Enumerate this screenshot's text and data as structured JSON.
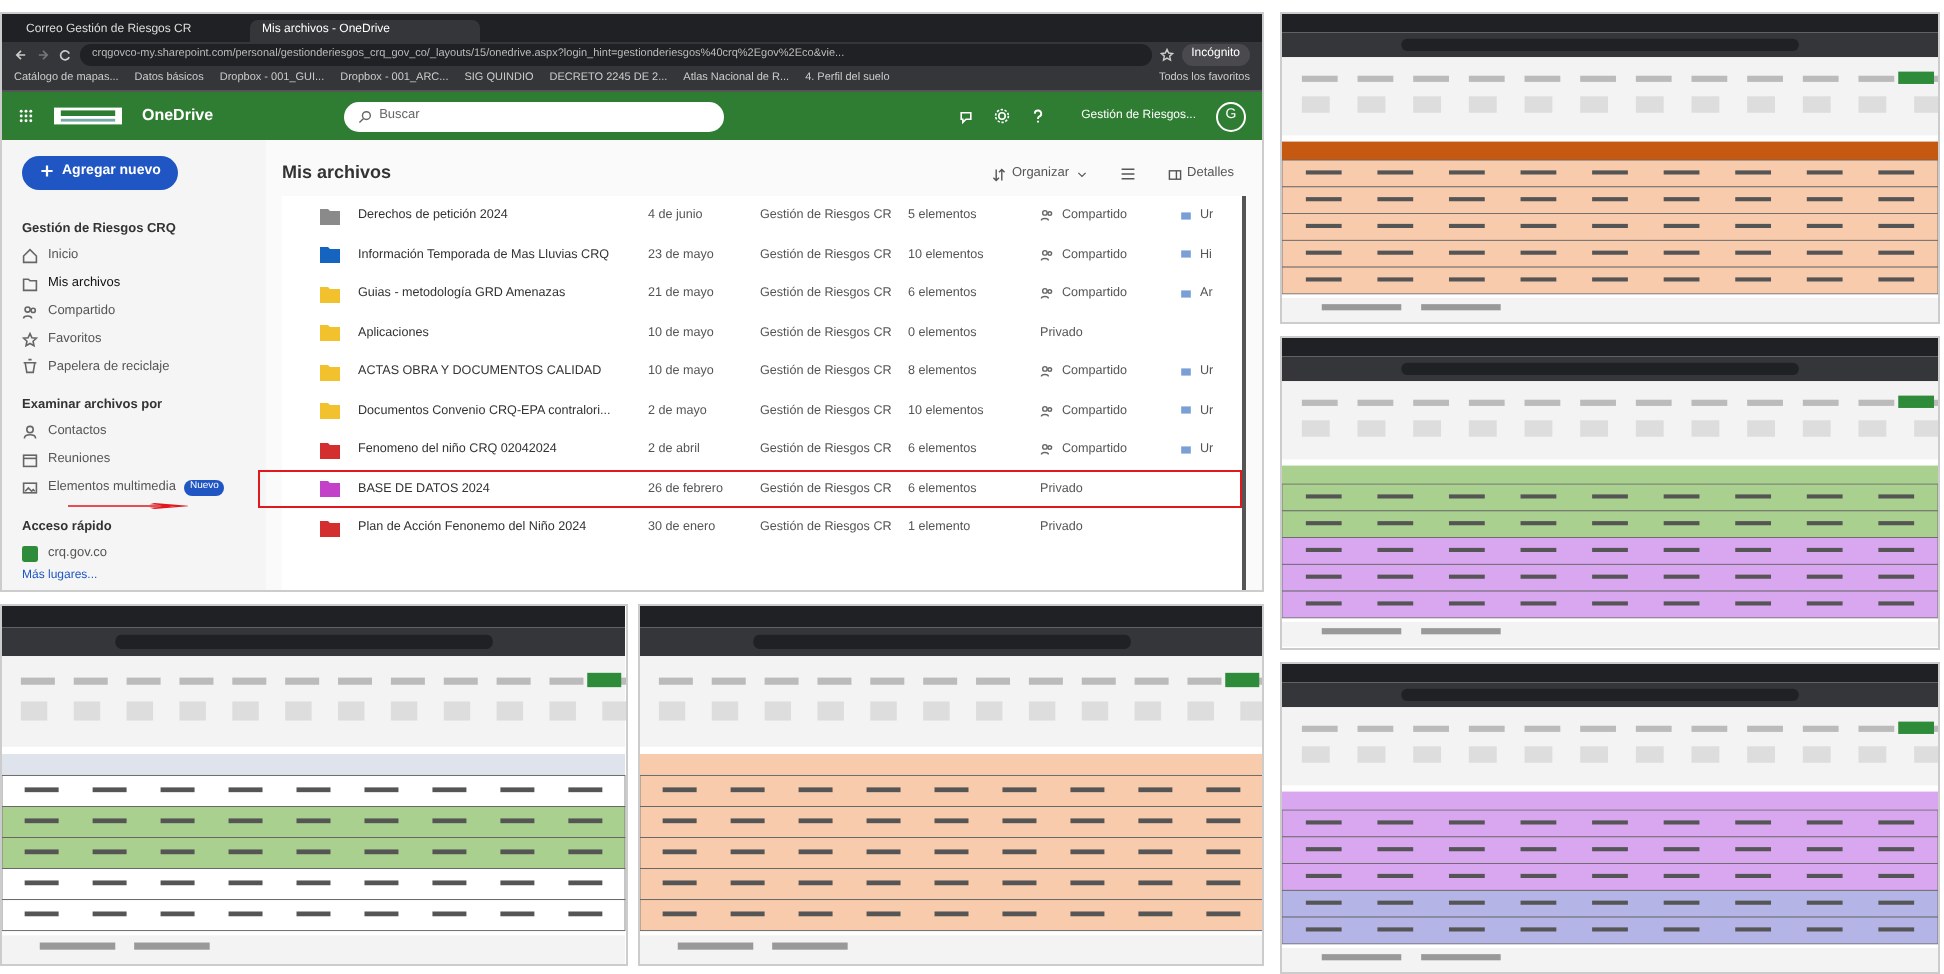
{
  "browser": {
    "tabs": [
      {
        "label": "Correo Gestión de Riesgos CR",
        "selected": false
      },
      {
        "label": "Mis archivos - OneDrive",
        "selected": true
      }
    ],
    "url": "crqgovco-my.sharepoint.com/personal/gestionderiesgos_crq_gov_co/_layouts/15/onedrive.aspx?login_hint=gestionderiesgos%40crq%2Egov%2Eco&vie...",
    "profile": "Incógnito",
    "bookmarks": [
      "Catálogo de mapas...",
      "Datos básicos",
      "Dropbox - 001_GUI...",
      "Dropbox - 001_ARC...",
      "SIG QUINDIO",
      "DECRETO 2245 DE 2...",
      "Atlas Nacional de R...",
      "4. Perfil del suelo"
    ],
    "all_bookmarks": "Todos los favoritos"
  },
  "app": {
    "name": "OneDrive",
    "search_placeholder": "Buscar",
    "account": "Gestión de Riesgos...",
    "avatar": "G"
  },
  "sidebar": {
    "new_button": "Agregar nuevo",
    "sections": [
      {
        "title": "Gestión de Riesgos CRQ",
        "items": [
          {
            "label": "Inicio",
            "selected": false
          },
          {
            "label": "Mis archivos",
            "selected": true
          },
          {
            "label": "Compartido",
            "selected": false
          },
          {
            "label": "Favoritos",
            "selected": false
          },
          {
            "label": "Papelera de reciclaje",
            "selected": false
          }
        ]
      },
      {
        "title": "Examinar archivos por",
        "items": [
          {
            "label": "Contactos",
            "selected": false
          },
          {
            "label": "Reuniones",
            "selected": false
          },
          {
            "label": "Elementos multimedia",
            "selected": false,
            "badge": "Nuevo"
          }
        ]
      },
      {
        "title": "Acceso rápido",
        "items": [
          {
            "label": "crq.gov.co",
            "selected": false
          }
        ]
      }
    ],
    "more": "Más lugares..."
  },
  "toolbar": {
    "title": "Mis archivos",
    "sort": "Organizar",
    "details": "Detalles"
  },
  "files": [
    {
      "name": "Derechos de petición 2024",
      "color": "#8a8a8a",
      "modified": "4 de junio",
      "owner": "Gestión de Riesgos CR",
      "size": "5 elementos",
      "sharing": "Compartido",
      "shared": true,
      "activity": "Ur",
      "highlighted": false
    },
    {
      "name": "Información Temporada de Mas Lluvias CRQ",
      "color": "#1565c0",
      "modified": "23 de mayo",
      "owner": "Gestión de Riesgos CR",
      "size": "10 elementos",
      "sharing": "Compartido",
      "shared": true,
      "activity": "Hi",
      "highlighted": false
    },
    {
      "name": "Guias - metodología GRD Amenazas",
      "color": "#f2c12e",
      "modified": "21 de mayo",
      "owner": "Gestión de Riesgos CR",
      "size": "6 elementos",
      "sharing": "Compartido",
      "shared": true,
      "activity": "Ar",
      "highlighted": false
    },
    {
      "name": "Aplicaciones",
      "color": "#f2c12e",
      "modified": "10 de mayo",
      "owner": "Gestión de Riesgos CR",
      "size": "0 elementos",
      "sharing": "Privado",
      "shared": false,
      "highlighted": false
    },
    {
      "name": "ACTAS OBRA Y DOCUMENTOS CALIDAD",
      "color": "#f2c12e",
      "modified": "10 de mayo",
      "owner": "Gestión de Riesgos CR",
      "size": "8 elementos",
      "sharing": "Compartido",
      "shared": true,
      "activity": "Ur",
      "highlighted": false
    },
    {
      "name": "Documentos Convenio CRQ-EPA contralori...",
      "color": "#f2c12e",
      "modified": "2 de mayo",
      "owner": "Gestión de Riesgos CR",
      "size": "10 elementos",
      "sharing": "Compartido",
      "shared": true,
      "activity": "Ur",
      "highlighted": false
    },
    {
      "name": "Fenomeno del niño CRQ 02042024",
      "color": "#d32f2f",
      "modified": "2 de abril",
      "owner": "Gestión de Riesgos CR",
      "size": "6 elementos",
      "sharing": "Compartido",
      "shared": true,
      "activity": "Ur",
      "highlighted": false
    },
    {
      "name": "BASE DE DATOS 2024",
      "color": "#c341c9",
      "modified": "26 de febrero",
      "owner": "Gestión de Riesgos CR",
      "size": "6 elementos",
      "sharing": "Privado",
      "shared": false,
      "highlighted": true
    },
    {
      "name": "Plan de Acción Fenonemo del Niño 2024",
      "color": "#d32f2f",
      "modified": "30 de enero",
      "owner": "Gestión de Riesgos CR",
      "size": "1 elemento",
      "sharing": "Privado",
      "shared": false,
      "highlighted": false
    }
  ],
  "thumbnails": [
    {
      "header": {
        "color": "#c65911"
      },
      "rows": [
        {
          "color": "#f8cbad"
        },
        {
          "color": "#f8cbad"
        },
        {
          "color": "#f8cbad"
        },
        {
          "color": "#f8cbad"
        },
        {
          "color": "#f8cbad"
        }
      ]
    },
    {
      "header": {
        "color": "#a9d08e"
      },
      "rows": [
        {
          "color": "#a9d08e"
        },
        {
          "color": "#a9d08e"
        },
        {
          "color": "#d9a6f0"
        },
        {
          "color": "#d9a6f0"
        },
        {
          "color": "#d9a6f0"
        }
      ]
    },
    {
      "header": {
        "color": "#d9a6f0"
      },
      "rows": [
        {
          "color": "#d9a6f0"
        },
        {
          "color": "#d9a6f0"
        },
        {
          "color": "#d9a6f0"
        },
        {
          "color": "#b4b4e6"
        },
        {
          "color": "#b4b4e6"
        }
      ]
    },
    {
      "header": {
        "color": "#dfe4ec"
      },
      "rows": [
        {
          "color": "#ffffff"
        },
        {
          "color": "#a9d08e"
        },
        {
          "color": "#a9d08e"
        },
        {
          "color": "#ffffff"
        },
        {
          "color": "#ffffff"
        }
      ]
    },
    {
      "header": {
        "color": "#f8cbad"
      },
      "rows": [
        {
          "color": "#f8cbad"
        },
        {
          "color": "#f8cbad"
        },
        {
          "color": "#f8cbad"
        },
        {
          "color": "#f8cbad"
        },
        {
          "color": "#f8cbad"
        }
      ]
    }
  ]
}
